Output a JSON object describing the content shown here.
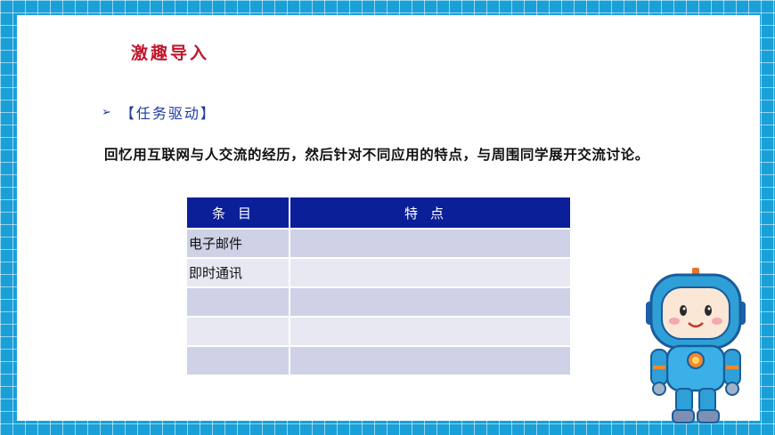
{
  "title": "激趣导入",
  "task": {
    "arrow": "➢",
    "label": "【任务驱动】"
  },
  "paragraph": "回忆用互联网与人交流的经历，然后针对不同应用的特点，与周围同学展开交流讨论。",
  "table": {
    "headers": [
      "条目",
      "特点"
    ],
    "rows": [
      [
        "电子邮件",
        ""
      ],
      [
        "即时通讯",
        ""
      ],
      [
        "",
        ""
      ],
      [
        "",
        ""
      ],
      [
        "",
        ""
      ]
    ]
  },
  "colors": {
    "background_grid": "#1aa0d8",
    "title_red": "#c0172c",
    "task_blue": "#1f3a9e",
    "table_header": "#0b1f99",
    "row_odd": "#cfd1e6",
    "row_even": "#e7e8f2"
  },
  "illustration": "robot-mascot-icon"
}
